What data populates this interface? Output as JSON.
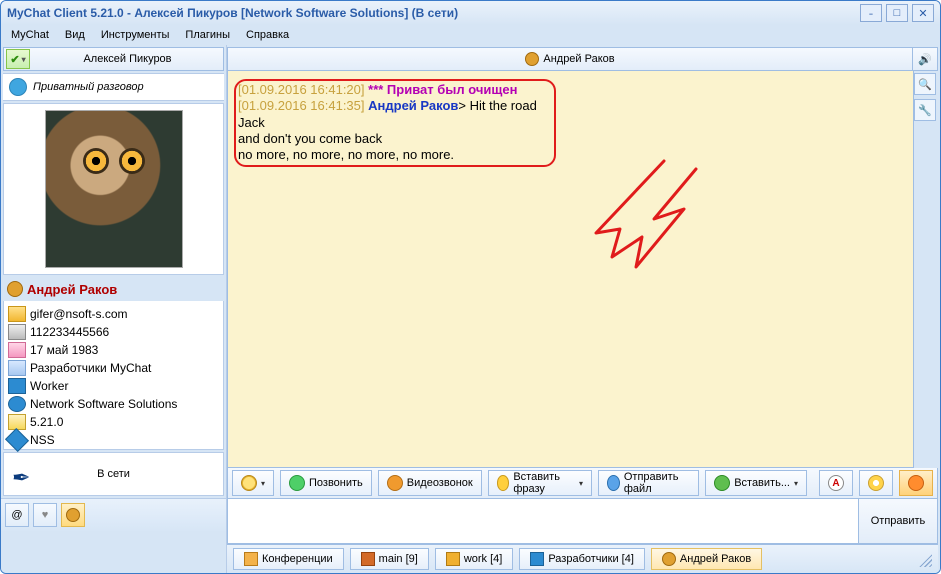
{
  "window": {
    "title": "MyChat Client 5.21.0 - Алексей Пикуров [Network Software Solutions] (В сети)"
  },
  "menu": [
    "MyChat",
    "Вид",
    "Инструменты",
    "Плагины",
    "Справка"
  ],
  "left": {
    "self_name": "Алексей Пикуров",
    "mode_label": "Приватный разговор",
    "contact_name": "Андрей Раков",
    "info": {
      "email": "gifer@nsoft-s.com",
      "phone": "112233445566",
      "birthday": "17 май 1983",
      "group": "Разработчики MyChat",
      "role": "Worker",
      "org": "Network Software Solutions",
      "version": "5.21.0",
      "extra": "NSS"
    },
    "presence": "В сети"
  },
  "chat": {
    "header_name": "Андрей Раков",
    "lines": [
      {
        "ts": "[01.09.2016 16:41:20]",
        "system": "*** Приват был очищен"
      },
      {
        "ts": "[01.09.2016 16:41:35]",
        "sender": "Андрей Раков",
        "text_lines": [
          "Hit the road Jack",
          "and don't you come back",
          "no more, no more, no more, no more."
        ]
      }
    ]
  },
  "toolbar": {
    "call": "Позвонить",
    "video": "Видеозвонок",
    "phrase": "Вставить фразу",
    "send_file": "Отправить файл",
    "paste": "Вставить...",
    "font_a": "A"
  },
  "input": {
    "send": "Отправить"
  },
  "tabs": [
    {
      "key": "conf",
      "label": "Конференции"
    },
    {
      "key": "main",
      "label": "main [9]"
    },
    {
      "key": "work",
      "label": "work [4]"
    },
    {
      "key": "dev",
      "label": "Разработчики [4]"
    },
    {
      "key": "user",
      "label": "Андрей Раков"
    }
  ]
}
